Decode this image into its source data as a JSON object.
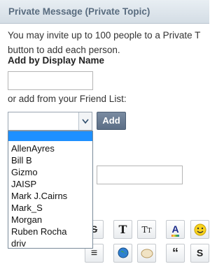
{
  "header": {
    "title": "Private Message (Private Topic)"
  },
  "intro": {
    "line1": "You may invite up to 100 people to a Private T",
    "line2": "button to add each person."
  },
  "add_by_name": {
    "label": "Add by Display Name",
    "value": ""
  },
  "friend_list": {
    "label": "or add from your Friend List:",
    "selected": "",
    "add_label": "Add",
    "options": [
      "",
      "AllenAyres",
      "Bill B",
      "Gizmo",
      "JAISP",
      "Mark J.Cairns",
      "Mark_S",
      "Morgan",
      "Ruben Rocha",
      "driv"
    ]
  },
  "toolbar": {
    "row1": [
      {
        "name": "strikethrough-icon",
        "glyph": "S"
      },
      {
        "name": "font-icon",
        "glyph": "T"
      },
      {
        "name": "font-size-icon",
        "glyph": "TT"
      },
      {
        "name": "text-color-icon",
        "glyph": "A"
      },
      {
        "name": "smiley-icon",
        "glyph": "☺"
      }
    ],
    "row2": [
      {
        "name": "justify-icon",
        "glyph": "≡"
      },
      {
        "name": "globe-link-icon",
        "glyph": "◉"
      },
      {
        "name": "image-icon",
        "glyph": "◒"
      },
      {
        "name": "quote-icon",
        "glyph": "“"
      },
      {
        "name": "spoiler-icon",
        "glyph": "S̶"
      }
    ]
  }
}
